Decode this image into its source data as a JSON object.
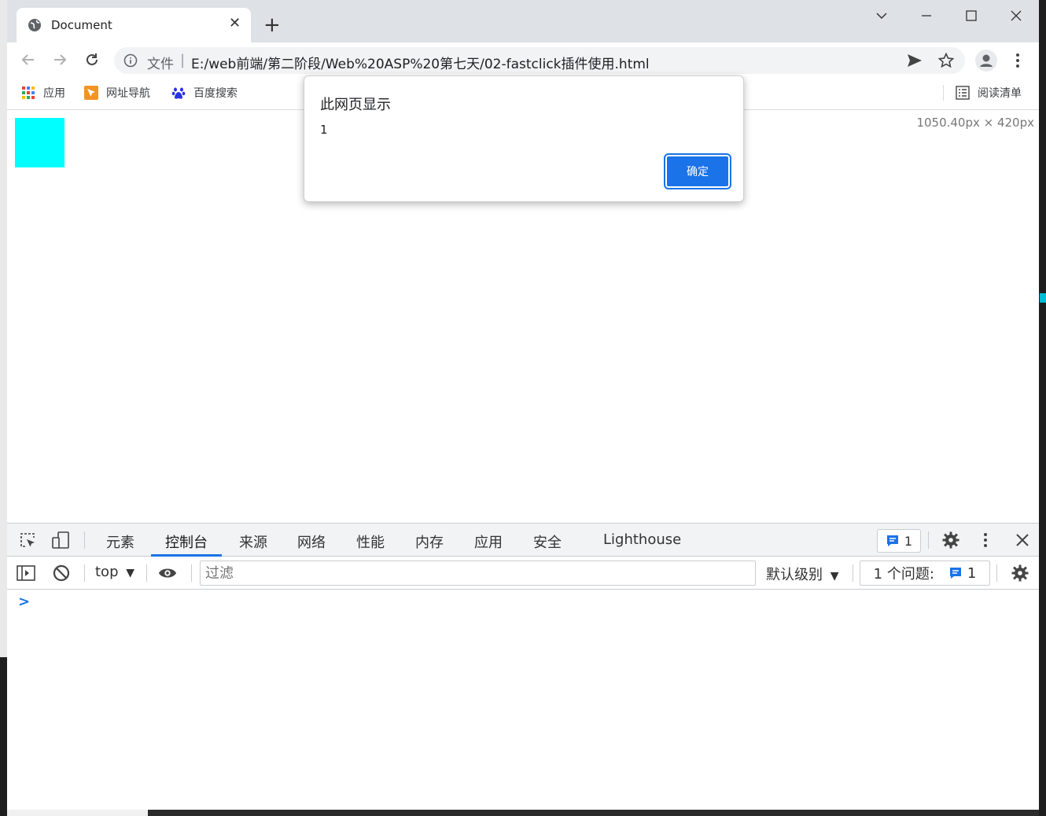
{
  "browser": {
    "tab_title": "Document",
    "url_label": "文件",
    "url_separator": "|",
    "url": "E:/web前端/第二阶段/Web%20ASP%20第七天/02-fastclick插件使用.html"
  },
  "bookmarks": {
    "items": [
      {
        "label": "应用"
      },
      {
        "label": "网址导航"
      },
      {
        "label": "百度搜索"
      }
    ],
    "reading_list": "阅读清单"
  },
  "viewport": {
    "size_readout": "1050.40px × 420px",
    "box_color": "#00ffff"
  },
  "dialog": {
    "title": "此网页显示",
    "message": "1",
    "ok_label": "确定"
  },
  "devtools": {
    "tabs": [
      {
        "label": "元素"
      },
      {
        "label": "控制台",
        "active": true
      },
      {
        "label": "来源"
      },
      {
        "label": "网络"
      },
      {
        "label": "性能"
      },
      {
        "label": "内存"
      },
      {
        "label": "应用"
      },
      {
        "label": "安全"
      },
      {
        "label": "Lighthouse"
      }
    ],
    "issues_badge": "1",
    "context": "top",
    "context_arrow": "▼",
    "filter_placeholder": "过滤",
    "level": "默认级别",
    "level_arrow": "▼",
    "issues_label": "1 个问题:",
    "issues_count": "1",
    "prompt": ">"
  },
  "colors": {
    "accent": "#1a73e8",
    "tabstrip": "#dee1e6"
  }
}
